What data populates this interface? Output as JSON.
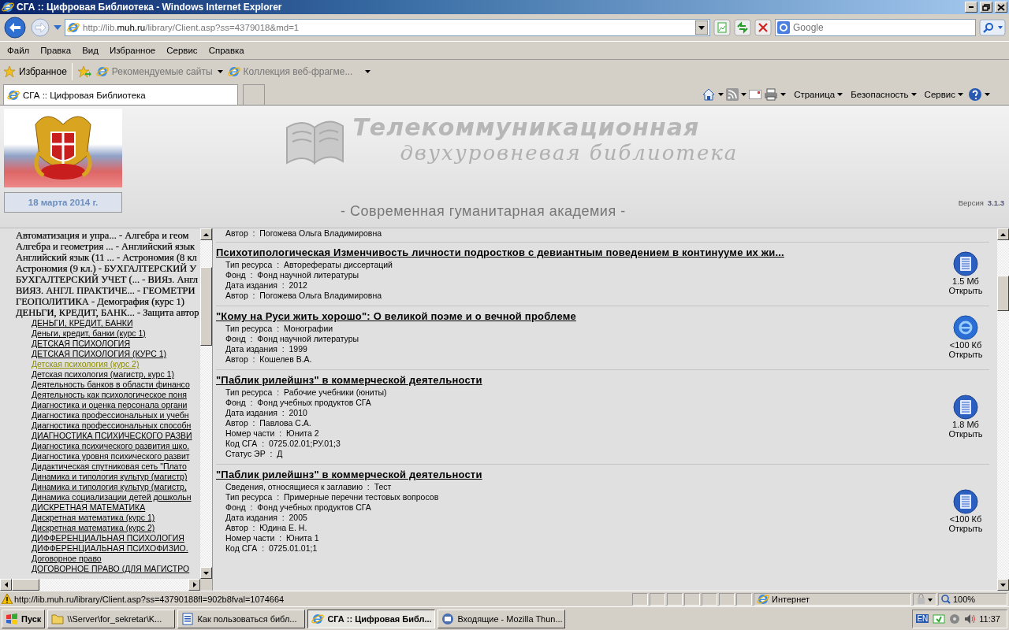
{
  "window": {
    "title": "СГА :: Цифровая Библиотека - Windows Internet Explorer"
  },
  "address_bar": {
    "url": "http://lib.**muh.ru**/library/Client.asp?ss=4379018&md=1"
  },
  "search": {
    "placeholder": "Google"
  },
  "menu": [
    "Файл",
    "Правка",
    "Вид",
    "Избранное",
    "Сервис",
    "Справка"
  ],
  "favorites_bar": {
    "favorites": "Избранное",
    "links": [
      "Рекомендуемые сайты",
      "Коллекция веб-фрагме..."
    ]
  },
  "tabs": [
    {
      "label": "СГА :: Цифровая Библиотека",
      "selected": true
    }
  ],
  "command_bar": [
    "Страница",
    "Безопасность",
    "Сервис"
  ],
  "site_header": {
    "date": "18 марта 2014 г.",
    "logo_line1": "Телекоммуникационная",
    "logo_line2": "двухуровневая библиотека",
    "academy": "- Современная гуманитарная академия -",
    "version_label": "Версия",
    "version": "3.1.3"
  },
  "tree": [
    {
      "label": "Автоматизация и упра... - Алгебра и геом"
    },
    {
      "label": "Алгебра и геометрия ... - Английский язык"
    },
    {
      "label": "Английский язык (11 ... - Астрономия (8 кл"
    },
    {
      "label": "Астрономия (9 кл.) - БУХГАЛТЕРСКИЙ У"
    },
    {
      "label": "БУХГАЛТЕРСКИЙ УЧЕТ (... - ВИЯз. Англ"
    },
    {
      "label": "ВИЯЗ. АНГЛ. ПРАКТИЧЕ... - ГЕОМЕТРИ"
    },
    {
      "label": "ГЕОПОЛИТИКА - Демография (курс 1)"
    },
    {
      "label": "ДЕНЬГИ, КРЕДИТ, БАНК... - Защита автор",
      "children": [
        {
          "label": "ДЕНЬГИ, КРЕДИТ, БАНКИ",
          "selected": false
        },
        {
          "label": "Деньги, кредит, банки (курс 1)",
          "selected": false
        },
        {
          "label": "ДЕТСКАЯ ПСИХОЛОГИЯ",
          "selected": false
        },
        {
          "label": "ДЕТСКАЯ ПСИХОЛОГИЯ (КУРС 1)",
          "selected": false
        },
        {
          "label": "Детская психология (курс 2)",
          "selected": true
        },
        {
          "label": "Детская психология (магистр, курс 1)",
          "selected": false
        },
        {
          "label": "Деятельность банков в области финансо",
          "selected": false
        },
        {
          "label": "Деятельность как психологическое поня",
          "selected": false
        },
        {
          "label": "Диагностика и оценка персонала органи",
          "selected": false
        },
        {
          "label": "Диагностика профессиональных и учебн",
          "selected": false
        },
        {
          "label": "Диагностика профессиональных способн",
          "selected": false
        },
        {
          "label": "ДИАГНОСТИКА ПСИХИЧЕСКОГО РАЗВИ",
          "selected": false
        },
        {
          "label": "Диагностика психического развития шко.",
          "selected": false
        },
        {
          "label": "Диагностика уровня психического развит",
          "selected": false
        },
        {
          "label": "Дидактическая спутниковая сеть \"Плато",
          "selected": false
        },
        {
          "label": "Динамика и типология культур (магистр)",
          "selected": false
        },
        {
          "label": "Динамика и типология культур (магистр,",
          "selected": false
        },
        {
          "label": "Динамика социализации детей дошкольн",
          "selected": false
        },
        {
          "label": "ДИСКРЕТНАЯ МАТЕМАТИКА",
          "selected": false
        },
        {
          "label": "Дискретная математика (курс 1)",
          "selected": false
        },
        {
          "label": "Дискретная математика (курс 2)",
          "selected": false
        },
        {
          "label": "ДИФФЕРЕНЦИАЛЬНАЯ ПСИХОЛОГИЯ",
          "selected": false
        },
        {
          "label": "ДИФФЕРЕНЦИАЛЬНАЯ ПСИХОФИЗИО.",
          "selected": false
        },
        {
          "label": "Договорное право",
          "selected": false
        },
        {
          "label": "ДОГОВОРНОЕ ПРАВО (ДЛЯ МАГИСТРО",
          "selected": false
        }
      ]
    }
  ],
  "results_top_line": "Автор  :  Погожева Ольга Владимировна",
  "results": [
    {
      "title": "Психотипологическая Изменчивость личности подростков с девиантным поведением в континууме их жи...",
      "fields": [
        "Тип ресурса  :  Авторефераты диссертаций",
        "Фонд  :  Фонд научной литературы",
        "Дата издания  :  2012",
        "Автор  :  Погожева Ольга Владимировна"
      ],
      "file": {
        "kind": "document",
        "size": "1.5 Мб",
        "link": "Открыть"
      }
    },
    {
      "title": "\"Кому на Руси жить хорошо\": О великой поэме и о вечной проблеме",
      "fields": [
        "Тип ресурса  :  Монографии",
        "Фонд  :  Фонд научной литературы",
        "Дата издания  :  1999",
        "Автор  :  Кошелев В.А."
      ],
      "file": {
        "kind": "web",
        "size": "<100 Кб",
        "link": "Открыть"
      }
    },
    {
      "title": "\"Паблик рилейшнз\" в коммерческой деятельности",
      "fields": [
        "Тип ресурса  :  Рабочие учебники (юниты)",
        "Фонд  :  Фонд учебных продуктов СГА",
        "Дата издания  :  2010",
        "Автор  :  Павлова С.А.",
        "Номер части  :  Юнита 2",
        "Код СГА  :  0725.02.01;РУ.01;3",
        "Статус ЭР  :  Д"
      ],
      "file": {
        "kind": "document",
        "size": "1.8 Мб",
        "link": "Открыть"
      }
    },
    {
      "title": "\"Паблик рилейшнз\" в коммерческой деятельности",
      "fields": [
        "Сведения, относящиеся к заглавию  :  Тест",
        "Тип ресурса  :  Примерные перечни тестовых вопросов",
        "Фонд  :  Фонд учебных продуктов СГА",
        "Дата издания  :  2005",
        "Автор  :  Юдина Е. Н.",
        "Номер части  :  Юнита 1",
        "Код СГА  :  0725.01.01;1"
      ],
      "file": {
        "kind": "document",
        "size": "<100 Кб",
        "link": "Открыть"
      }
    }
  ],
  "status_bar": {
    "url": "http://lib.muh.ru/library/Client.asp?ss=43790188fl=902b8fval=1074664",
    "zone": "Интернет",
    "zoom": "100%"
  },
  "taskbar": {
    "start": "Пуск",
    "tasks": [
      {
        "label": "\\\\Server\\for_sekretar\\K...",
        "kind": "folder",
        "selected": false
      },
      {
        "label": "Как пользоваться библ...",
        "kind": "word",
        "selected": false
      },
      {
        "label": "СГА :: Цифровая Библ...",
        "kind": "browser",
        "selected": true
      },
      {
        "label": "Входящие - Mozilla Thun...",
        "kind": "mail",
        "selected": false
      }
    ],
    "language": "EN",
    "clock": "11:37"
  }
}
